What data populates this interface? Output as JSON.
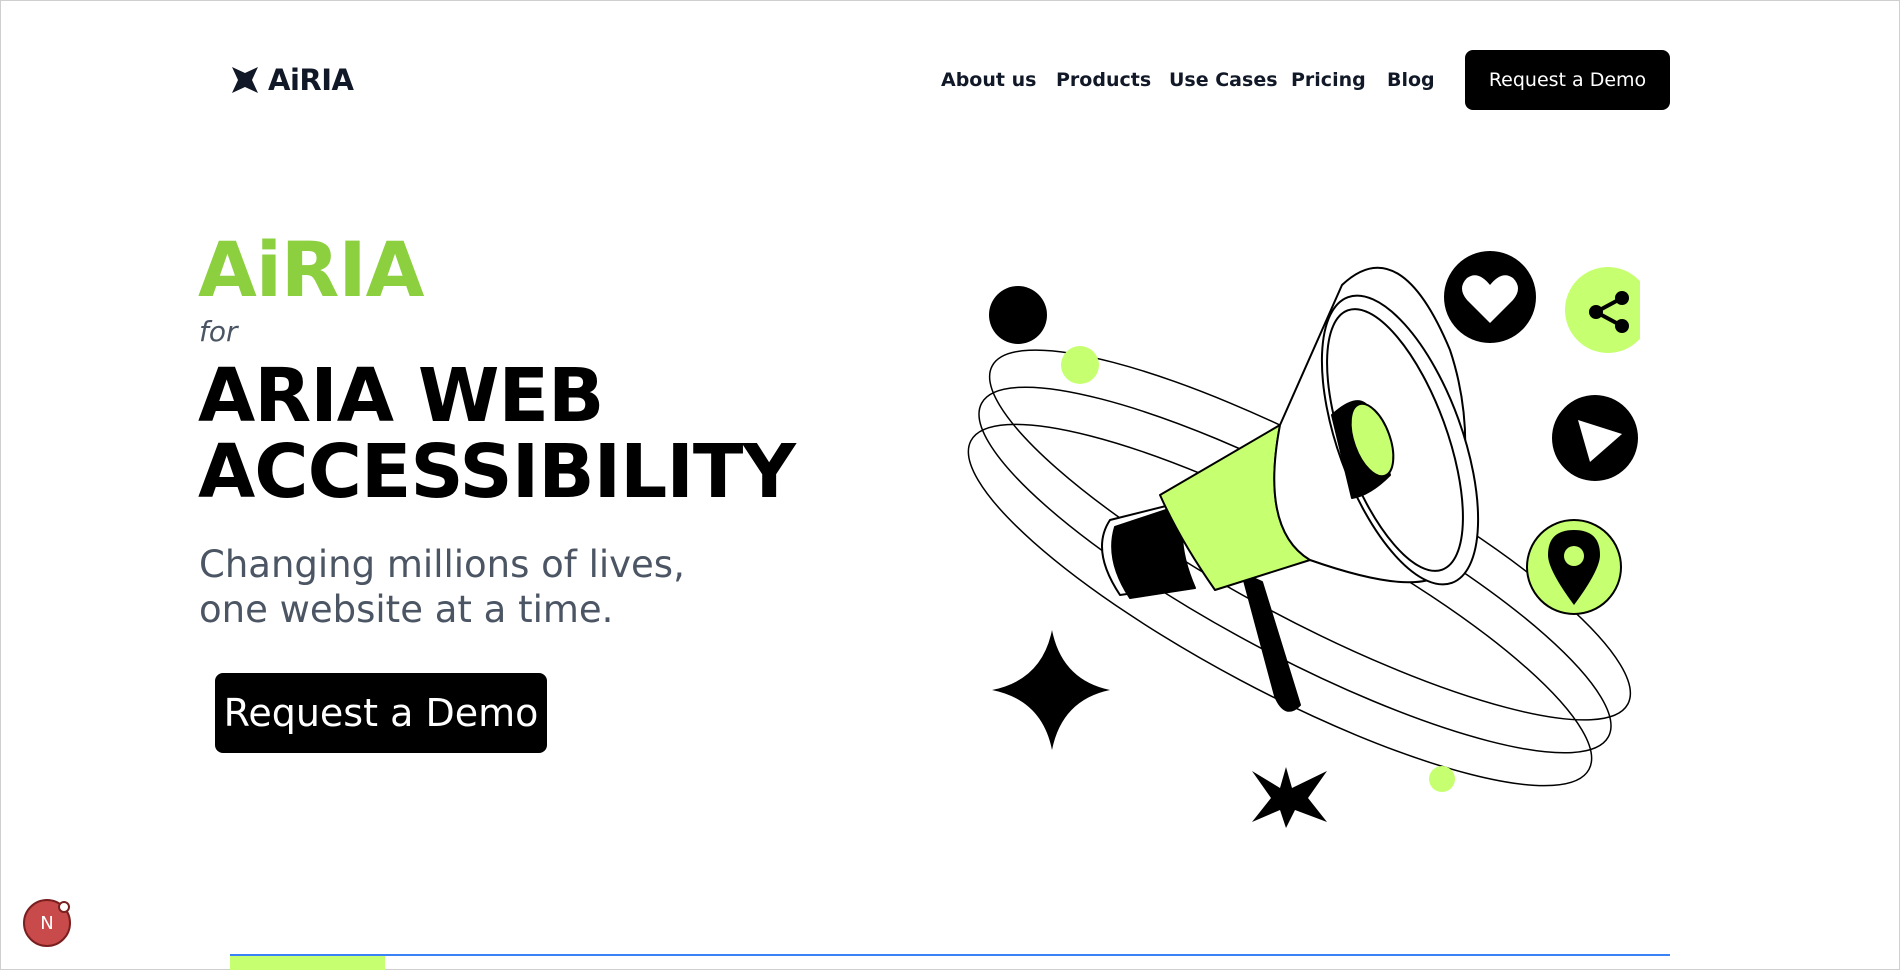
{
  "header": {
    "logo_text": "AiRIA",
    "nav": [
      "About us",
      "Products",
      "Use Cases",
      "Pricing",
      "Blog"
    ],
    "cta_label": "Request a Demo"
  },
  "hero": {
    "brand": "AiRIA",
    "for": "for",
    "headline_line1": "ARIA WEB",
    "headline_line2": "ACCESSIBILITY",
    "subline_line1": "Changing millions of lives,",
    "subline_line2": "one website at a time.",
    "cta_label": "Request a Demo"
  },
  "badge": {
    "letter": "N"
  },
  "colors": {
    "brand_green": "#8ccf3f",
    "accent_lime": "#c6ff6f",
    "primary_black": "#000000",
    "text_gray": "#4b5563",
    "progress_blue": "#3b82f6"
  },
  "icons": [
    "logo-star-icon",
    "heart-icon",
    "share-icon",
    "play-icon",
    "location-pin-icon",
    "megaphone-icon",
    "four-point-star-icon"
  ]
}
